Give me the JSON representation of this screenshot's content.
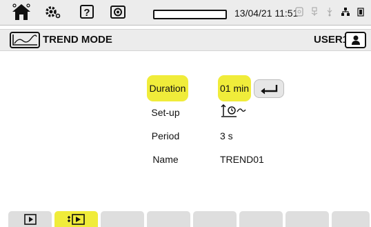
{
  "topbar": {
    "icons": [
      "home-icon",
      "settings-icon",
      "help-icon",
      "camera-icon"
    ],
    "datetime": "13/04/21 11:51",
    "progress": 0
  },
  "mode": {
    "title": "TREND MODE",
    "user": "USER1",
    "icon": "trend-graph-icon"
  },
  "form": {
    "duration_label": "Duration",
    "duration_value": "01 min",
    "setup_label": "Set-up",
    "setup_icon": "recording-setup-icon",
    "period_label": "Period",
    "period_value": "3 s",
    "name_label": "Name",
    "name_value": "TREND01"
  },
  "colors": {
    "highlight": "#f0ec3a",
    "bar_bg": "#ececec",
    "tab_bg": "#dedede"
  },
  "tabs": [
    {
      "icon": "play-icon",
      "active": false
    },
    {
      "icon": "record-config-icon",
      "active": true
    },
    {
      "icon": "",
      "active": false
    },
    {
      "icon": "",
      "active": false
    },
    {
      "icon": "",
      "active": false
    },
    {
      "icon": "",
      "active": false
    },
    {
      "icon": "",
      "active": false
    },
    {
      "icon": "",
      "active": false
    }
  ]
}
